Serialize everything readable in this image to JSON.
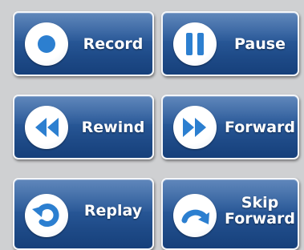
{
  "colors": {
    "background": "#cfd0d2",
    "button_blue": "#245293",
    "icon_blue": "#2c7fd0",
    "label": "#ffffff"
  },
  "buttons": [
    {
      "label": "Record",
      "icon": "record-icon"
    },
    {
      "label": "Pause",
      "icon": "pause-icon"
    },
    {
      "label": "Rewind",
      "icon": "rewind-icon"
    },
    {
      "label": "Forward",
      "icon": "forward-icon"
    },
    {
      "label": "Replay",
      "icon": "replay-icon"
    },
    {
      "label": "Skip\nForward",
      "icon": "skip-forward-icon"
    }
  ]
}
